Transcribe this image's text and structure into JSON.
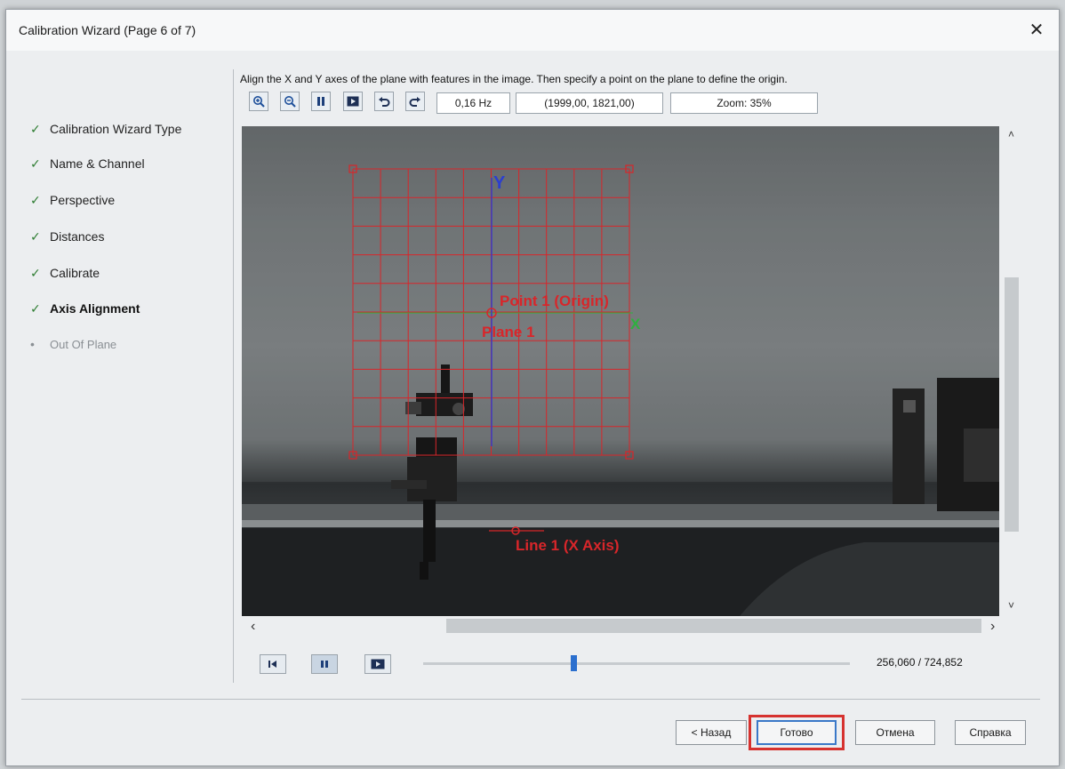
{
  "window": {
    "title": "Calibration Wizard (Page 6 of 7)",
    "close_glyph": "✕"
  },
  "steps": [
    {
      "label": "Calibration Wizard Type",
      "status": "done",
      "mark": "✓"
    },
    {
      "label": "Name & Channel",
      "status": "done",
      "mark": "✓"
    },
    {
      "label": "Perspective",
      "status": "done",
      "mark": "✓"
    },
    {
      "label": "Distances",
      "status": "done",
      "mark": "✓"
    },
    {
      "label": "Calibrate",
      "status": "done",
      "mark": "✓"
    },
    {
      "label": "Axis Alignment",
      "status": "current",
      "mark": "✓"
    },
    {
      "label": "Out Of Plane",
      "status": "pending",
      "mark": "•"
    }
  ],
  "instruction": "Align the X and Y axes of the plane with features in the image. Then specify a point on the plane to define the origin.",
  "toolbar": {
    "icons": [
      "zoom-in-icon",
      "zoom-out-icon",
      "pause-icon",
      "play-frame-icon",
      "undo-icon",
      "redo-icon"
    ],
    "frequency": "0,16 Hz",
    "coordinates": "(1999,00, 1821,00)",
    "zoom": "Zoom: 35%"
  },
  "overlay": {
    "y_axis_label": "Y",
    "x_axis_label": "X",
    "origin_label": "Point 1 (Origin)",
    "plane_label": "Plane 1",
    "line_label": "Line 1 (X Axis)",
    "grid_color": "#d8262a",
    "y_axis_color": "#2b3fd0",
    "x_axis_color": "#2fb03f"
  },
  "playback": {
    "icons": [
      "go-to-start-icon",
      "pause-icon",
      "play-icon"
    ],
    "position_fraction": 0.353,
    "frame_counter": "256,060 / 724,852"
  },
  "buttons": {
    "back": "< Назад",
    "finish": "Готово",
    "cancel": "Отмена",
    "help": "Справка"
  },
  "scroll": {
    "up": "˄",
    "down": "˅",
    "left": "‹",
    "right": "›"
  }
}
